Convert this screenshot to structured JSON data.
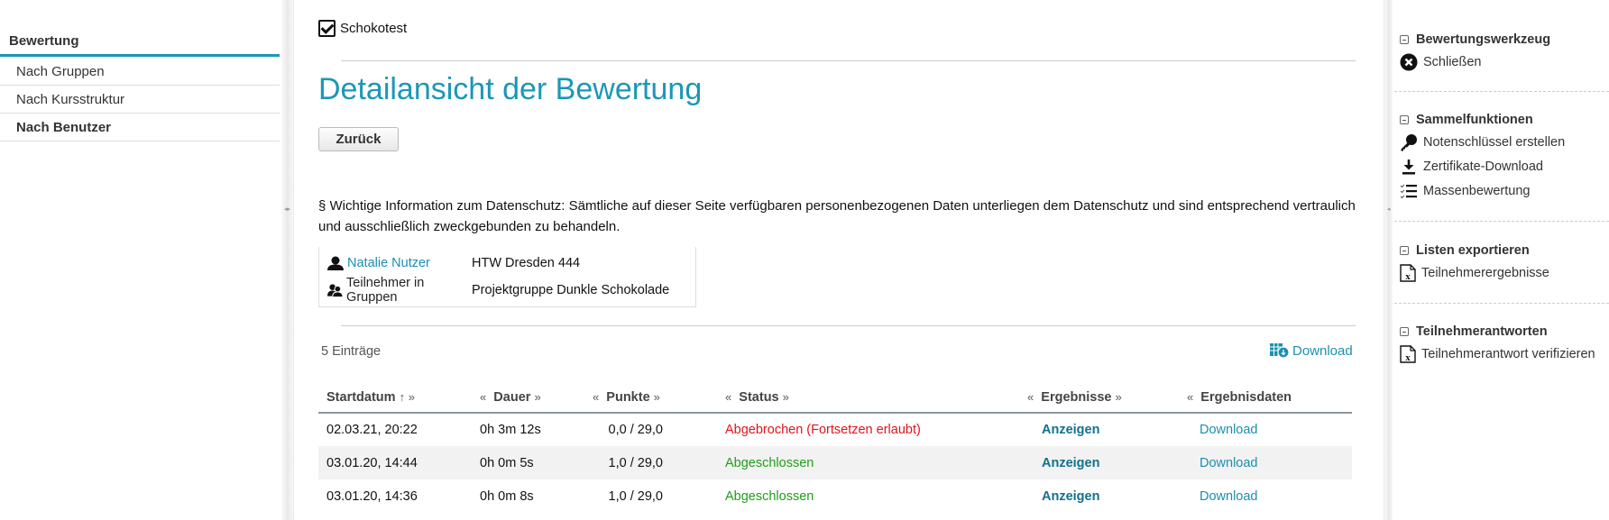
{
  "left_nav": {
    "heading": "Bewertung",
    "items": [
      {
        "label": "Nach Gruppen",
        "active": false
      },
      {
        "label": "Nach Kursstruktur",
        "active": false
      },
      {
        "label": "Nach Benutzer",
        "active": true
      }
    ]
  },
  "main": {
    "breadcrumb": {
      "icon": "test-checkbox-icon",
      "label": "Schokotest"
    },
    "title": "Detailansicht der Bewertung",
    "back_button": "Zurück",
    "privacy_notice": "§ Wichtige Information zum Datenschutz: Sämtliche auf dieser Seite verfügbaren personenbezogenen Daten unterliegen dem Datenschutz und sind entsprechend vertraulich und ausschließlich zweckgebunden zu behandeln.",
    "info": {
      "user": {
        "icon": "user-icon",
        "name": "Natalie Nutzer",
        "value": "HTW Dresden 444"
      },
      "groups": {
        "icon": "group-icon",
        "label": "Teilnehmer in Gruppen",
        "value": "Projektgruppe Dunkle Schokolade"
      }
    },
    "entry_count": "5 Einträge",
    "download_label": "Download",
    "table": {
      "columns": [
        {
          "label": "Startdatum",
          "prefix": "",
          "suffix": "↑ »"
        },
        {
          "label": "Dauer",
          "prefix": "«",
          "suffix": "»"
        },
        {
          "label": "Punkte",
          "prefix": "«",
          "suffix": "»"
        },
        {
          "label": "Status",
          "prefix": "«",
          "suffix": "»"
        },
        {
          "label": "Ergebnisse",
          "prefix": "«",
          "suffix": "»"
        },
        {
          "label": "Ergebnisdaten",
          "prefix": "«",
          "suffix": ""
        }
      ],
      "rows": [
        {
          "start": "02.03.21, 20:22",
          "duration": "0h 3m 12s",
          "points": "0,0 / 29,0",
          "status": "Abgebrochen (Fortsetzen erlaubt)",
          "status_type": "aborted",
          "results": "Anzeigen",
          "data": "Download"
        },
        {
          "start": "03.01.20, 14:44",
          "duration": "0h 0m 5s",
          "points": "1,0 / 29,0",
          "status": "Abgeschlossen",
          "status_type": "done",
          "results": "Anzeigen",
          "data": "Download"
        },
        {
          "start": "03.01.20, 14:36",
          "duration": "0h 0m 8s",
          "points": "1,0 / 29,0",
          "status": "Abgeschlossen",
          "status_type": "done",
          "results": "Anzeigen",
          "data": "Download"
        }
      ]
    }
  },
  "right_panel": {
    "sections": [
      {
        "title": "Bewertungswerkzeug",
        "items": [
          {
            "label": "Schließen",
            "icon": "close-circle-icon"
          }
        ]
      },
      {
        "title": "Sammelfunktionen",
        "items": [
          {
            "label": "Notenschlüssel erstellen",
            "icon": "key-icon"
          },
          {
            "label": "Zertifikate-Download",
            "icon": "download-icon"
          },
          {
            "label": "Massenbewertung",
            "icon": "checklist-icon"
          }
        ]
      },
      {
        "title": "Listen exportieren",
        "items": [
          {
            "label": "Teilnehmerergebnisse",
            "icon": "excel-file-icon"
          }
        ]
      },
      {
        "title": "Teilnehmerantworten",
        "items": [
          {
            "label": "Teilnehmerantwort verifizieren",
            "icon": "excel-file-icon"
          }
        ]
      }
    ]
  },
  "colors": {
    "accent": "#1b97b8",
    "link": "#1b8fb0",
    "status_aborted": "#e0131b",
    "status_done": "#1f9e19"
  }
}
